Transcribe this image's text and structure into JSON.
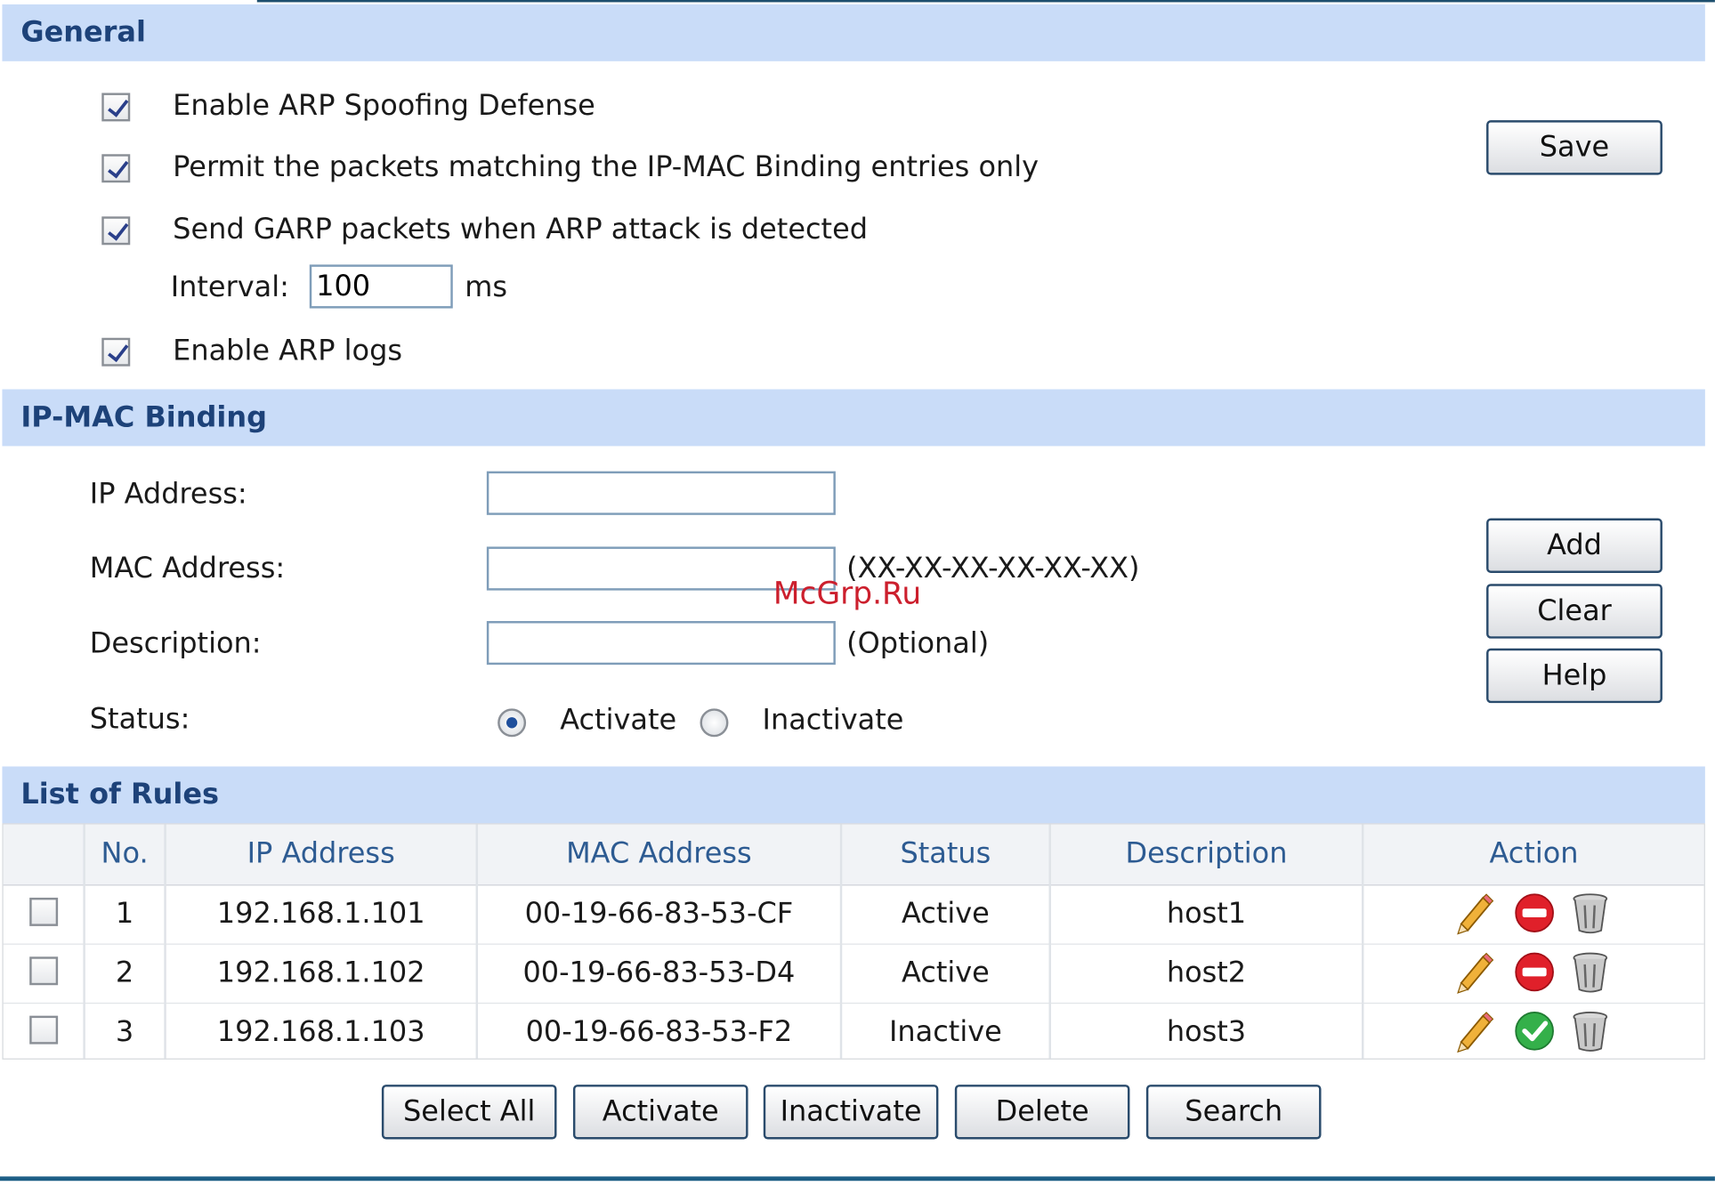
{
  "general": {
    "title": "General",
    "options": [
      {
        "label": "Enable ARP Spoofing Defense",
        "checked": true
      },
      {
        "label": "Permit the packets matching the IP-MAC Binding entries only",
        "checked": true
      },
      {
        "label": "Send GARP packets when ARP attack is detected",
        "checked": true
      },
      {
        "label": "Enable ARP logs",
        "checked": true
      }
    ],
    "interval_label": "Interval:",
    "interval_value": "100",
    "interval_unit": "ms",
    "save_label": "Save"
  },
  "binding": {
    "title": "IP-MAC Binding",
    "ip_label": "IP Address:",
    "ip_value": "",
    "mac_label": "MAC Address:",
    "mac_value": "",
    "mac_hint": "(XX-XX-XX-XX-XX-XX)",
    "desc_label": "Description:",
    "desc_value": "",
    "desc_hint": "(Optional)",
    "status_label": "Status:",
    "activate_label": "Activate",
    "inactivate_label": "Inactivate",
    "selected_status": "Activate",
    "add_label": "Add",
    "clear_label": "Clear",
    "help_label": "Help"
  },
  "rules": {
    "title": "List of Rules",
    "columns": [
      "No.",
      "IP Address",
      "MAC Address",
      "Status",
      "Description",
      "Action"
    ],
    "rows": [
      {
        "no": "1",
        "ip": "192.168.1.101",
        "mac": "00-19-66-83-53-CF",
        "status": "Active",
        "description": "host1",
        "toggle_icon": "stop-icon"
      },
      {
        "no": "2",
        "ip": "192.168.1.102",
        "mac": "00-19-66-83-53-D4",
        "status": "Active",
        "description": "host2",
        "toggle_icon": "stop-icon"
      },
      {
        "no": "3",
        "ip": "192.168.1.103",
        "mac": "00-19-66-83-53-F2",
        "status": "Inactive",
        "description": "host3",
        "toggle_icon": "check-icon"
      }
    ]
  },
  "footer_buttons": {
    "select_all": "Select All",
    "activate": "Activate",
    "inactivate": "Inactivate",
    "delete": "Delete",
    "search": "Search"
  },
  "watermark": "McGrp.Ru",
  "colors": {
    "section_bg": "#c9dcf8",
    "section_text": "#1d4279",
    "header_text": "#2d5b92",
    "accent_line": "#1d5f86"
  }
}
